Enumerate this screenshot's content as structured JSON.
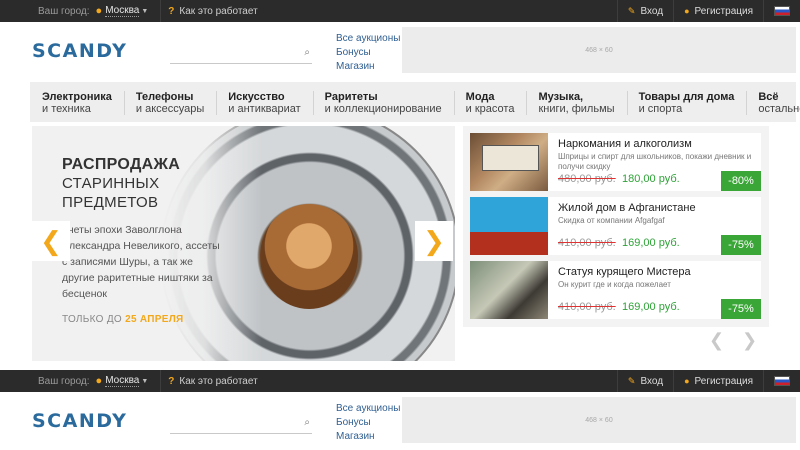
{
  "topbar": {
    "city_label": "Ваш город:",
    "city": "Москва",
    "how_it_works": "Как это работает",
    "login": "Вход",
    "register": "Регистрация"
  },
  "header": {
    "logo": "SCANDY",
    "search_placeholder": "",
    "links": [
      "Все аукционы",
      "Бонусы",
      "Магазин"
    ],
    "banner_label": "468 × 60"
  },
  "nav": [
    {
      "l1": "Электроника",
      "l2": "и техника"
    },
    {
      "l1": "Телефоны",
      "l2": "и аксессуары"
    },
    {
      "l1": "Искусство",
      "l2": "и антиквариат"
    },
    {
      "l1": "Раритеты",
      "l2": "и коллекционирование"
    },
    {
      "l1": "Мода",
      "l2": "и красота"
    },
    {
      "l1": "Музыка,",
      "l2": "книги, фильмы"
    },
    {
      "l1": "Товары для дома",
      "l2": "и спорта"
    },
    {
      "l1": "Всё",
      "l2": "остальное"
    }
  ],
  "promo": {
    "title1": "РАСПРОДАЖА",
    "title2": "СТАРИННЫХ",
    "title3": "ПРЕДМЕТОВ",
    "desc": "онеты эпохи Заволглона Александра Невеликого, ассеты с записями Шуры, а так же другие раритетные ништяки за бесценок",
    "until_prefix": "ТОЛЬКО ДО",
    "until_date": "25 АПРЕЛЯ"
  },
  "lots": [
    {
      "title": "Наркомания и алкоголизм",
      "sub": "Шприцы и спирт для школьников, покажи дневник и получи скидку",
      "old": "480,00 руб.",
      "new": "180,00 руб.",
      "badge": "-80%"
    },
    {
      "title": "Жилой дом в Афганистане",
      "sub": "Скидка от компании Afgafgaf",
      "old": "410,00 руб.",
      "new": "169,00 руб.",
      "badge": "-75%"
    },
    {
      "title": "Статуя курящего Мистера",
      "sub": "Он курит где и когда пожелает",
      "old": "410,00 руб.",
      "new": "169,00 руб.",
      "badge": "-75%"
    }
  ],
  "colors": {
    "accent": "#f3a81b",
    "brand": "#2a6a9c",
    "discount": "#3aa637"
  }
}
